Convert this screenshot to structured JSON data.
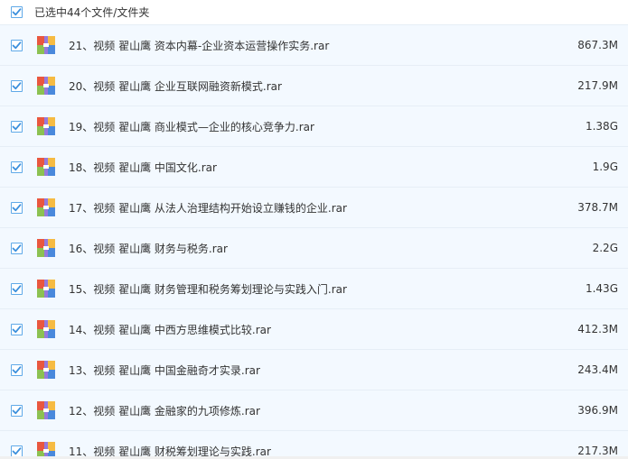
{
  "header": {
    "selection_label": "已选中44个文件/文件夹",
    "checked": true
  },
  "files": [
    {
      "name": "21、视频 翟山鹰 资本内幕-企业资本运营操作实务.rar",
      "size": "867.3M",
      "checked": true
    },
    {
      "name": "20、视频 翟山鹰 企业互联网融资新模式.rar",
      "size": "217.9M",
      "checked": true
    },
    {
      "name": "19、视频 翟山鹰 商业模式—企业的核心竞争力.rar",
      "size": "1.38G",
      "checked": true
    },
    {
      "name": "18、视频 翟山鹰 中国文化.rar",
      "size": "1.9G",
      "checked": true
    },
    {
      "name": "17、视频 翟山鹰 从法人治理结构开始设立赚钱的企业.rar",
      "size": "378.7M",
      "checked": true
    },
    {
      "name": "16、视频 翟山鹰 财务与税务.rar",
      "size": "2.2G",
      "checked": true
    },
    {
      "name": "15、视频 翟山鹰 财务管理和税务筹划理论与实践入门.rar",
      "size": "1.43G",
      "checked": true
    },
    {
      "name": "14、视频 翟山鹰 中西方思维模式比较.rar",
      "size": "412.3M",
      "checked": true
    },
    {
      "name": "13、视频 翟山鹰 中国金融奇才实录.rar",
      "size": "243.4M",
      "checked": true
    },
    {
      "name": "12、视频 翟山鹰 金融家的九项修炼.rar",
      "size": "396.9M",
      "checked": true
    },
    {
      "name": "11、视频 翟山鹰 财税筹划理论与实践.rar",
      "size": "217.3M",
      "checked": true
    }
  ],
  "colors": {
    "row_background": "#f3f9ff",
    "checkbox_border": "#5fa9e8",
    "checkmark": "#3a8fdc"
  },
  "icons": {
    "file_type": "archive-rar-icon",
    "check": "checkmark-icon"
  }
}
